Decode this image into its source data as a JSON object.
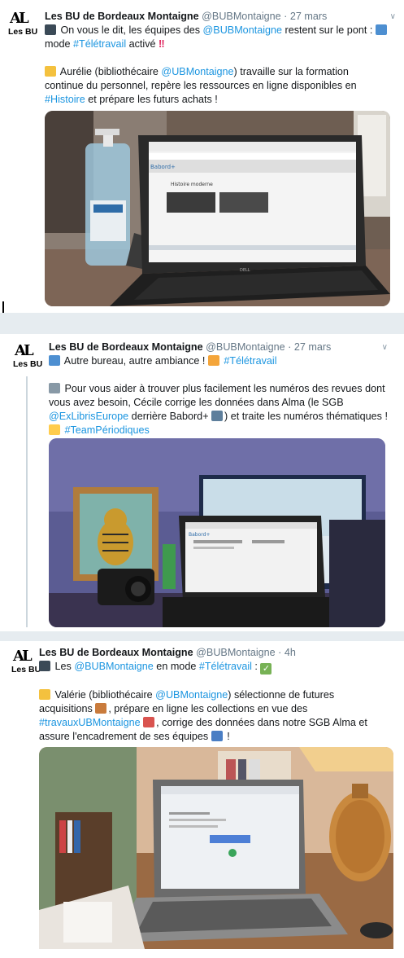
{
  "tweets": [
    {
      "author_name": "Les BU de Bordeaux Montaigne",
      "handle": "@BUBMontaigne",
      "separator": "·",
      "time": "27 mars",
      "avatar_text": "Les BU",
      "lines": [
        [
          [
            "e",
            "camera-emoji"
          ],
          [
            "t",
            " On vous le dit, les équipes des "
          ],
          [
            "l",
            "@BUBMontaigne"
          ],
          [
            "t",
            " restent sur le pont : "
          ],
          [
            "e",
            "laptop-emoji"
          ]
        ],
        [
          [
            "t",
            "mode "
          ],
          [
            "l",
            "#Télétravail"
          ],
          [
            "t",
            " activé "
          ],
          [
            "b",
            "‼"
          ]
        ],
        [],
        [
          [
            "e",
            "librarian-emoji"
          ],
          [
            "t",
            " Aurélie (bibliothécaire "
          ],
          [
            "l",
            "@UBMontaigne"
          ],
          [
            "t",
            ") travaille sur la formation"
          ]
        ],
        [
          [
            "t",
            "continue du personnel, repère les ressources en ligne disponibles en"
          ]
        ],
        [
          [
            "l",
            "#Histoire"
          ],
          [
            "t",
            " et prépare les futurs achats !"
          ]
        ]
      ],
      "screen_title": "Histoire moderne",
      "screen_brand": "Babord+",
      "laptop_brand": "DELL"
    },
    {
      "author_name": "Les BU de Bordeaux Montaigne",
      "handle": "@BUBMontaigne",
      "separator": "·",
      "time": "27 mars",
      "avatar_text": "Les BU",
      "lines": [
        [
          [
            "e",
            "laptop-emoji"
          ],
          [
            "t",
            " Autre bureau, autre ambiance ! "
          ],
          [
            "e",
            "cat-emoji"
          ],
          [
            "t",
            " "
          ],
          [
            "l",
            "#Télétravail"
          ]
        ],
        [],
        [
          [
            "e",
            "newspaper-emoji"
          ],
          [
            "t",
            " Pour vous aider à trouver plus facilement les numéros des revues dont"
          ]
        ],
        [
          [
            "t",
            "vous avez besoin, Cécile corrige les données dans Alma (le SGB"
          ]
        ],
        [
          [
            "l",
            "@ExLibrisEurope"
          ],
          [
            "t",
            " derrière Babord+ "
          ],
          [
            "e",
            "magnifier-emoji"
          ],
          [
            "t",
            ") et traite les numéros thématiques !"
          ]
        ],
        [
          [
            "e",
            "thumbs-up-emoji"
          ],
          [
            "t",
            " "
          ],
          [
            "l",
            "#TeamPériodiques"
          ]
        ]
      ],
      "screen_brand": "Babord+"
    },
    {
      "author_name": "Les BU de Bordeaux Montaigne",
      "handle": "@BUBMontaigne",
      "separator": "·",
      "time": "4h",
      "avatar_text": "Les BU",
      "lines": [
        [
          [
            "e",
            "camera-emoji"
          ],
          [
            "t",
            " Les "
          ],
          [
            "l",
            "@BUBMontaigne"
          ],
          [
            "t",
            " en mode "
          ],
          [
            "l",
            "#Télétravail"
          ],
          [
            "t",
            " : "
          ],
          [
            "c",
            "✓"
          ]
        ],
        [],
        [
          [
            "e",
            "librarian-emoji"
          ],
          [
            "t",
            " Valérie (bibliothécaire "
          ],
          [
            "l",
            "@UBMontaigne"
          ],
          [
            "t",
            ") sélectionne de futures"
          ]
        ],
        [
          [
            "t",
            "acquisitions "
          ],
          [
            "e",
            "books-emoji"
          ],
          [
            "t",
            ", prépare en ligne les collections en vue des"
          ]
        ],
        [
          [
            "l",
            "#travauxUBMontaigne"
          ],
          [
            "t",
            " "
          ],
          [
            "e",
            "crane-emoji"
          ],
          [
            "t",
            ", corrige des données dans notre SGB Alma et"
          ]
        ],
        [
          [
            "t",
            "assure l'encadrement de ses équipes "
          ],
          [
            "e",
            "people-emoji"
          ],
          [
            "t",
            " !"
          ]
        ]
      ]
    }
  ],
  "emoji_colors": {
    "camera-emoji": "#3b4a57",
    "laptop-emoji": "#4d8fd1",
    "librarian-emoji": "#f4c13e",
    "cat-emoji": "#f4a53a",
    "newspaper-emoji": "#8899a6",
    "magnifier-emoji": "#5e7f9c",
    "thumbs-up-emoji": "#ffcc4d",
    "books-emoji": "#c97b3c",
    "crane-emoji": "#d9534f",
    "people-emoji": "#4a7ec4"
  },
  "colors": {
    "link": "#1b95e0",
    "handle": "#657786",
    "name": "#14171a"
  }
}
